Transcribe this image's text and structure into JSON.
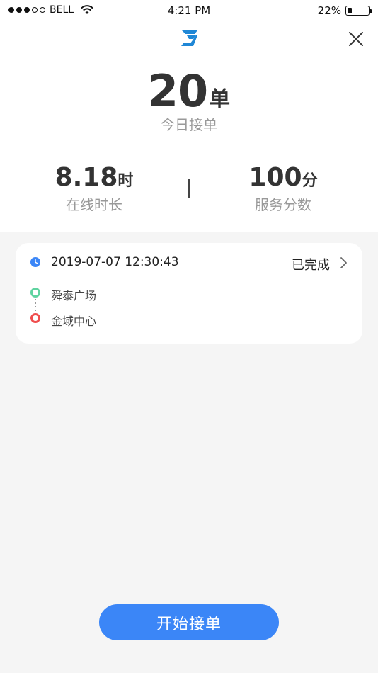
{
  "status_bar": {
    "carrier": "BELL",
    "time": "4:21 PM",
    "battery": "22%",
    "battery_level": 0.22,
    "signal_full": 3,
    "signal_total": 5
  },
  "header": {
    "logo_icon": "brand-logo-icon",
    "close_icon": "close-icon"
  },
  "summary": {
    "orders_value": "20",
    "orders_unit": "单",
    "orders_label": "今日接单",
    "online_value": "8.18",
    "online_unit": "时",
    "online_label": "在线时长",
    "score_value": "100",
    "score_unit": "分",
    "score_label": "服务分数"
  },
  "order": {
    "time": "2019-07-07 12:30:43",
    "status": "已完成",
    "from": "舜泰广场",
    "to": "金域中心"
  },
  "actions": {
    "start_label": "开始接单"
  },
  "colors": {
    "primary": "#3b86f7",
    "start_point": "#5fd3a0",
    "end_point": "#ef4d4d",
    "background": "#f5f5f5"
  }
}
